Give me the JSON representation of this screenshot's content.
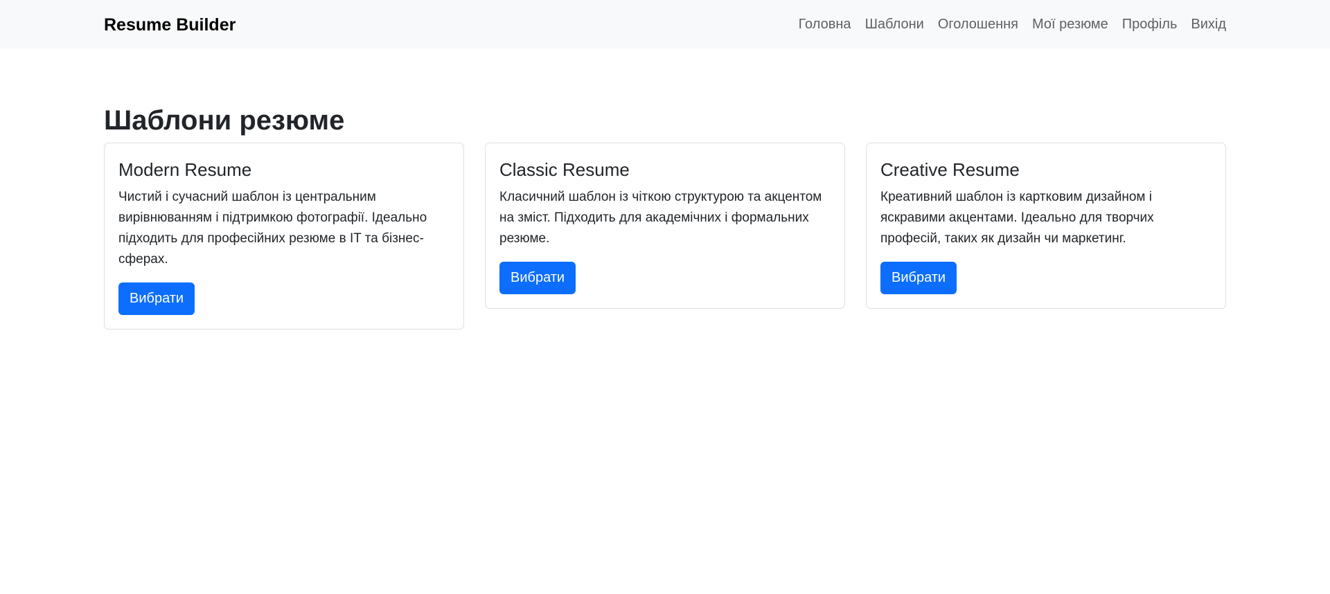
{
  "navbar": {
    "brand": "Resume Builder",
    "links": [
      "Головна",
      "Шаблони",
      "Оголошення",
      "Мої резюме",
      "Профіль",
      "Вихід"
    ]
  },
  "main": {
    "title": "Шаблони резюме",
    "cards": [
      {
        "title": "Modern Resume",
        "description": "Чистий і сучасний шаблон із центральним вирівнюванням і підтримкою фотографії. Ідеально підходить для професійних резюме в IT та бізнес-сферах.",
        "button": "Вибрати"
      },
      {
        "title": "Classic Resume",
        "description": "Класичний шаблон із чіткою структурою та акцентом на зміст. Підходить для академічних і формальних резюме.",
        "button": "Вибрати"
      },
      {
        "title": "Creative Resume",
        "description": "Креативний шаблон із картковим дизайном і яскравими акцентами. Ідеально для творчих професій, таких як дизайн чи маркетинг.",
        "button": "Вибрати"
      }
    ]
  },
  "colors": {
    "navbar_bg": "#f8f9fa",
    "primary": "#0d6efd",
    "text": "#212529",
    "nav_link": "#5c6166"
  }
}
